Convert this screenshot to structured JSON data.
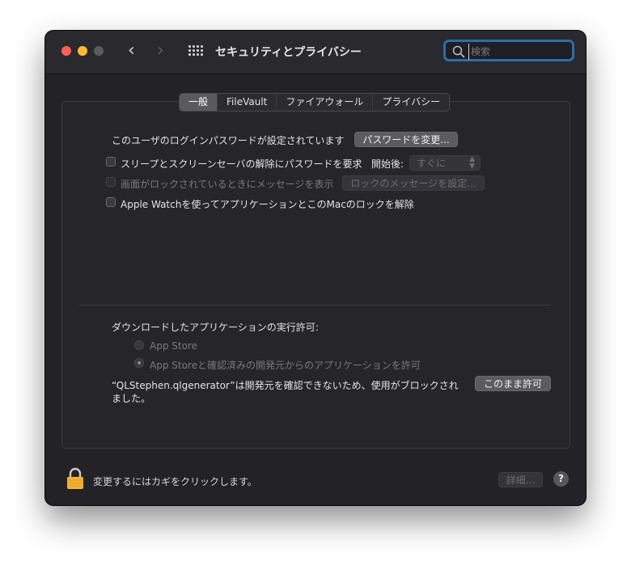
{
  "window": {
    "title": "セキュリティとプライバシー",
    "search": {
      "placeholder": "検索",
      "value": ""
    }
  },
  "tabs": [
    {
      "label": "一般",
      "selected": true
    },
    {
      "label": "FileVault",
      "selected": false
    },
    {
      "label": "ファイアウォール",
      "selected": false
    },
    {
      "label": "プライバシー",
      "selected": false
    }
  ],
  "general": {
    "login_password_text": "このユーザのログインパスワードが設定されています",
    "change_password_button": "パスワードを変更...",
    "require_password": {
      "label": "スリープとスクリーンセーバの解除にパスワードを要求",
      "checked": false,
      "after_label": "開始後:",
      "after_value": "すぐに"
    },
    "lock_message": {
      "label": "画面がロックされているときにメッセージを表示",
      "checked": false,
      "enabled": false,
      "button": "ロックのメッセージを設定..."
    },
    "apple_watch": {
      "label": "Apple Watchを使ってアプリケーションとこのMacのロックを解除",
      "checked": false
    }
  },
  "downloads": {
    "heading": "ダウンロードしたアプリケーションの実行許可:",
    "options": [
      {
        "label": "App Store",
        "selected": false
      },
      {
        "label": "App Storeと確認済みの開発元からのアプリケーションを許可",
        "selected": true
      }
    ],
    "blocked_line1": "“QLStephen.qlgenerator”は開発元を確認できないため、使用がブロックされ",
    "blocked_line2": "ました。",
    "allow_button": "このまま許可"
  },
  "footer": {
    "lock_text": "変更するにはカギをクリックします。",
    "advanced_button": "詳細...",
    "help_button": "?"
  },
  "colors": {
    "window_bg": "#232227",
    "accent_focus": "#2a6fa8",
    "lock": "#f5b335"
  }
}
